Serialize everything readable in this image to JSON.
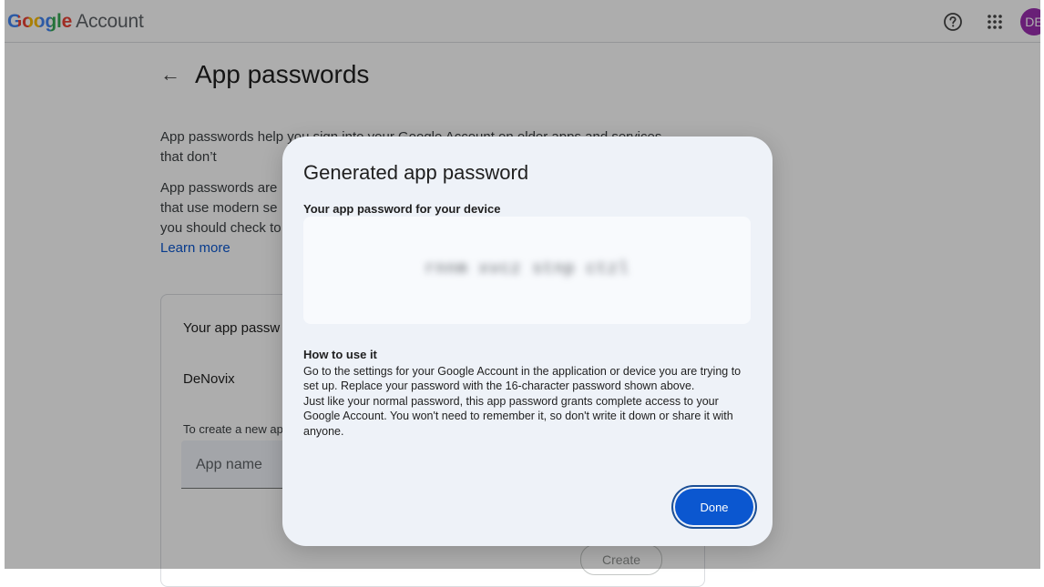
{
  "header": {
    "brand_google": "Google",
    "brand_account": "Account",
    "avatar_initials": "DE",
    "avatar_color": "#9b2fb0",
    "icons": [
      "help-icon",
      "apps-grid-icon"
    ]
  },
  "page": {
    "title": "App passwords",
    "intro_p1": "App passwords help you sign into your Google Account on older apps and services that don’t",
    "intro_p2_lines": [
      "App passwords are",
      "that use modern se",
      "you should check to"
    ],
    "learn_more": "Learn more"
  },
  "card": {
    "title": "Your app passw",
    "item": "DeNovix",
    "hint": "To create a new ap",
    "app_name_placeholder": "App name",
    "create_label": "Create"
  },
  "dialog": {
    "title": "Generated app password",
    "subtitle": "Your app password for your device",
    "password": "rnnm xvcz stnp ctzl",
    "howto_title": "How to use it",
    "howto_p1": "Go to the settings for your Google Account in the application or device you are trying to set up. Replace your password with the 16-character password shown above.",
    "howto_p2": "Just like your normal password, this app password grants complete access to your Google Account. You won't need to remember it, so don't write it down or share it with anyone.",
    "done_label": "Done",
    "accent": "#0b57d0"
  }
}
